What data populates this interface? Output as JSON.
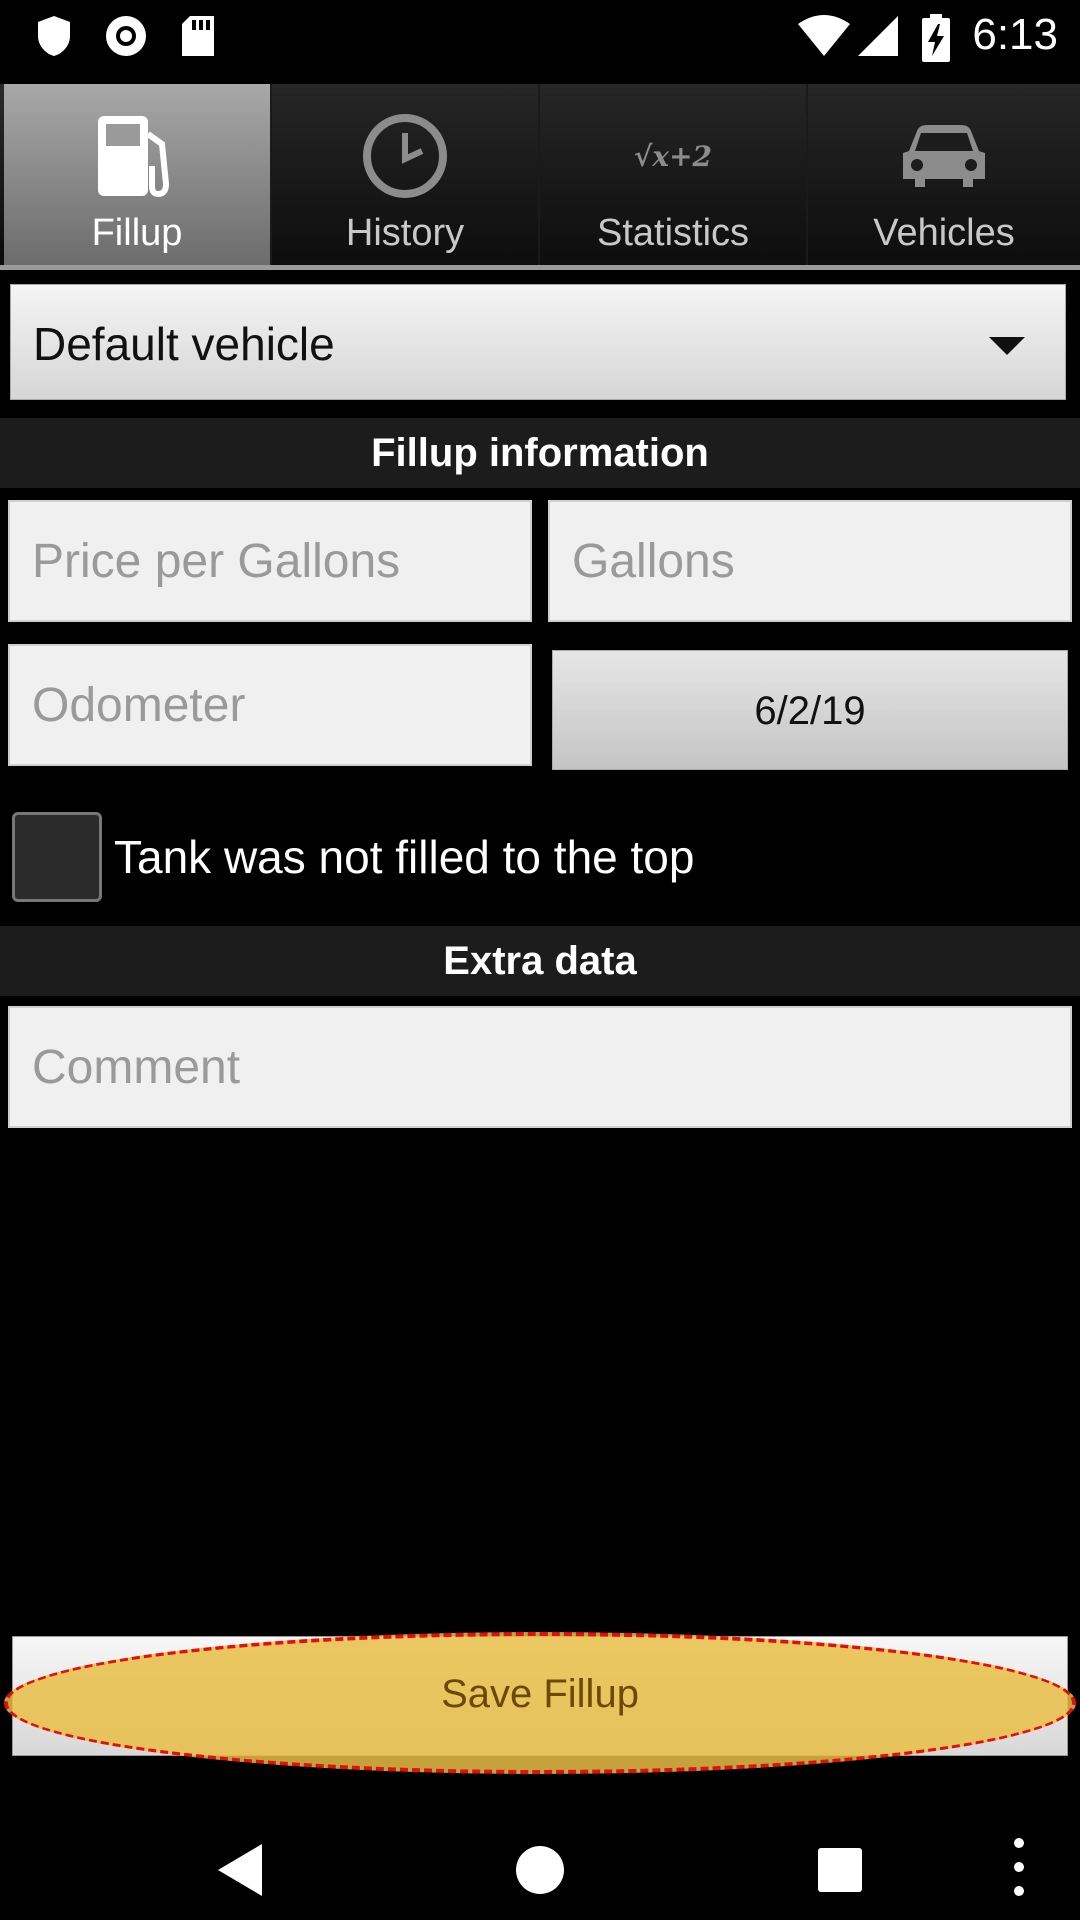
{
  "status_bar": {
    "time": "6:13",
    "left_icons": [
      "shield-icon",
      "record-icon",
      "sd-card-icon"
    ],
    "right_icons": [
      "wifi-icon",
      "signal-icon",
      "battery-charging-icon"
    ]
  },
  "tabs": [
    {
      "label": "Fillup",
      "icon": "fuel-pump-icon",
      "active": true
    },
    {
      "label": "History",
      "icon": "clock-icon",
      "active": false
    },
    {
      "label": "Statistics",
      "icon": "sqrt-formula-icon",
      "icon_text": "√x+2",
      "active": false
    },
    {
      "label": "Vehicles",
      "icon": "car-icon",
      "active": false
    }
  ],
  "vehicle_select": {
    "value": "Default vehicle"
  },
  "fillup_section": {
    "title": "Fillup information"
  },
  "fields": {
    "price_placeholder": "Price per Gallons",
    "gallons_placeholder": "Gallons",
    "odometer_placeholder": "Odometer",
    "date": "6/2/19"
  },
  "tank_checkbox": {
    "label": "Tank was not filled to the top",
    "checked": false
  },
  "extra_section": {
    "title": "Extra data"
  },
  "comment": {
    "placeholder": "Comment"
  },
  "save_button": {
    "label": "Save Fillup"
  },
  "colors": {
    "highlight": "#e8be46",
    "highlight_border": "#e01010",
    "active_tab": "#8a8a8a"
  }
}
